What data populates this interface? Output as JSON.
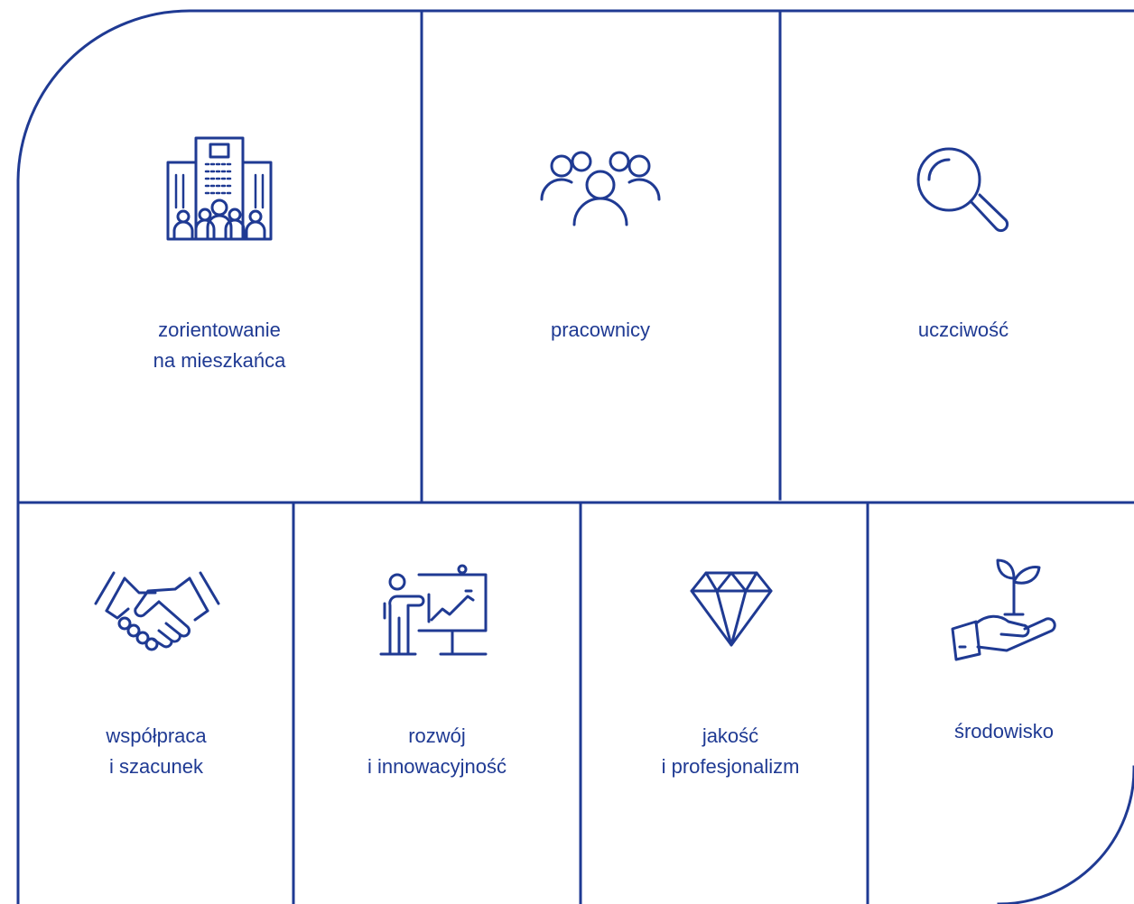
{
  "accent_color": "#1f3a93",
  "values": [
    {
      "icon": "office-building-people-icon",
      "lines": [
        "zorientowanie",
        "na mieszkańca"
      ]
    },
    {
      "icon": "people-group-icon",
      "lines": [
        "pracownicy"
      ]
    },
    {
      "icon": "magnifier-icon",
      "lines": [
        "uczciwość"
      ]
    },
    {
      "icon": "handshake-icon",
      "lines": [
        "współpraca",
        "i szacunek"
      ]
    },
    {
      "icon": "presentation-chart-icon",
      "lines": [
        "rozwój",
        "i innowacyjność"
      ]
    },
    {
      "icon": "diamond-icon",
      "lines": [
        "jakość",
        "i profesjonalizm"
      ]
    },
    {
      "icon": "hand-plant-icon",
      "lines": [
        "środowisko"
      ]
    }
  ]
}
